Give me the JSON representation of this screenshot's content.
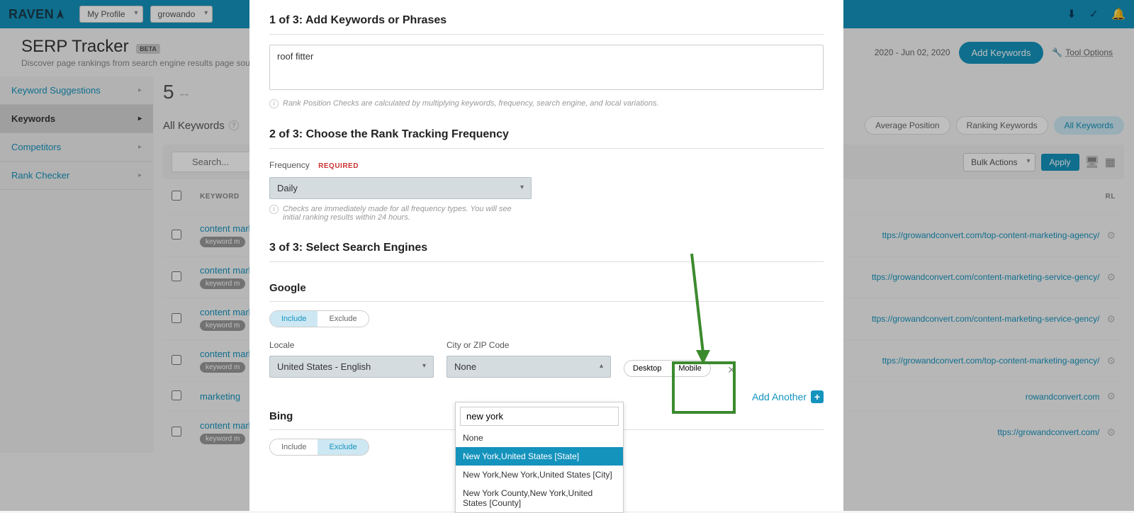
{
  "topbar": {
    "logo": "RAVEN",
    "profile_dd": "My Profile",
    "site_dd": "growando",
    "icons": {
      "a": "download-icon",
      "b": "checklist-icon",
      "c": "bell-icon"
    }
  },
  "page": {
    "title": "SERP Tracker",
    "badge": "BETA",
    "subtitle": "Discover page rankings from search engine results page sources.",
    "date_range": "2020 - Jun 02, 2020",
    "add_kw_btn": "Add Keywords",
    "tool_options": "Tool Options"
  },
  "sidebar": {
    "items": [
      {
        "label": "Keyword Suggestions",
        "active": false
      },
      {
        "label": "Keywords",
        "active": true
      },
      {
        "label": "Competitors",
        "active": false
      },
      {
        "label": "Rank Checker",
        "active": false
      }
    ]
  },
  "main": {
    "count": "5",
    "dash": "--",
    "section_title": "All Keywords",
    "pills": {
      "avg": "Average Position",
      "ranking": "Ranking Keywords",
      "all": "All Keywords"
    },
    "search_placeholder": "Search...",
    "bulk": "Bulk Actions",
    "apply": "Apply",
    "th_keyword": "KEYWORD",
    "th_url": "RL"
  },
  "rows": [
    {
      "kw": "content mark",
      "tag": "keyword m",
      "url": "ttps://growandconvert.com/top-content-marketing-agency/"
    },
    {
      "kw": "content mark",
      "tag": "keyword m",
      "url": "ttps://growandconvert.com/content-marketing-service-gency/"
    },
    {
      "kw": "content mark",
      "tag": "keyword m",
      "url": "ttps://growandconvert.com/content-marketing-service-gency/"
    },
    {
      "kw": "content mark",
      "tag": "keyword m",
      "url": "ttps://growandconvert.com/top-content-marketing-agency/"
    },
    {
      "kw": "marketing",
      "tag": "",
      "url": "rowandconvert.com"
    },
    {
      "kw": "content mark",
      "tag": "keyword m",
      "url": "ttps://growandconvert.com/"
    }
  ],
  "modal": {
    "step1_title": "1 of 3: Add Keywords or Phrases",
    "keywords_value": "roof fitter",
    "step1_hint": "Rank Position Checks are calculated by multiplying keywords, frequency, search engine, and local variations.",
    "step2_title": "2 of 3: Choose the Rank Tracking Frequency",
    "freq_label": "Frequency",
    "required": "REQUIRED",
    "freq_value": "Daily",
    "step2_hint": "Checks are immediately made for all frequency types. You will see initial ranking results within 24 hours.",
    "step3_title": "3 of 3: Select Search Engines",
    "google_title": "Google",
    "include": "Include",
    "exclude": "Exclude",
    "locale_label": "Locale",
    "locale_value": "United States - English",
    "city_label": "City or ZIP Code",
    "city_value": "None",
    "device_desktop": "Desktop",
    "device_mobile": "Mobile",
    "add_another": "Add Another",
    "bing_title": "Bing"
  },
  "autocomplete": {
    "query": "new york",
    "items": [
      "None",
      "New York,United States [State]",
      "New York,New York,United States [City]",
      "New York County,New York,United States [County]"
    ],
    "selected_index": 1
  }
}
